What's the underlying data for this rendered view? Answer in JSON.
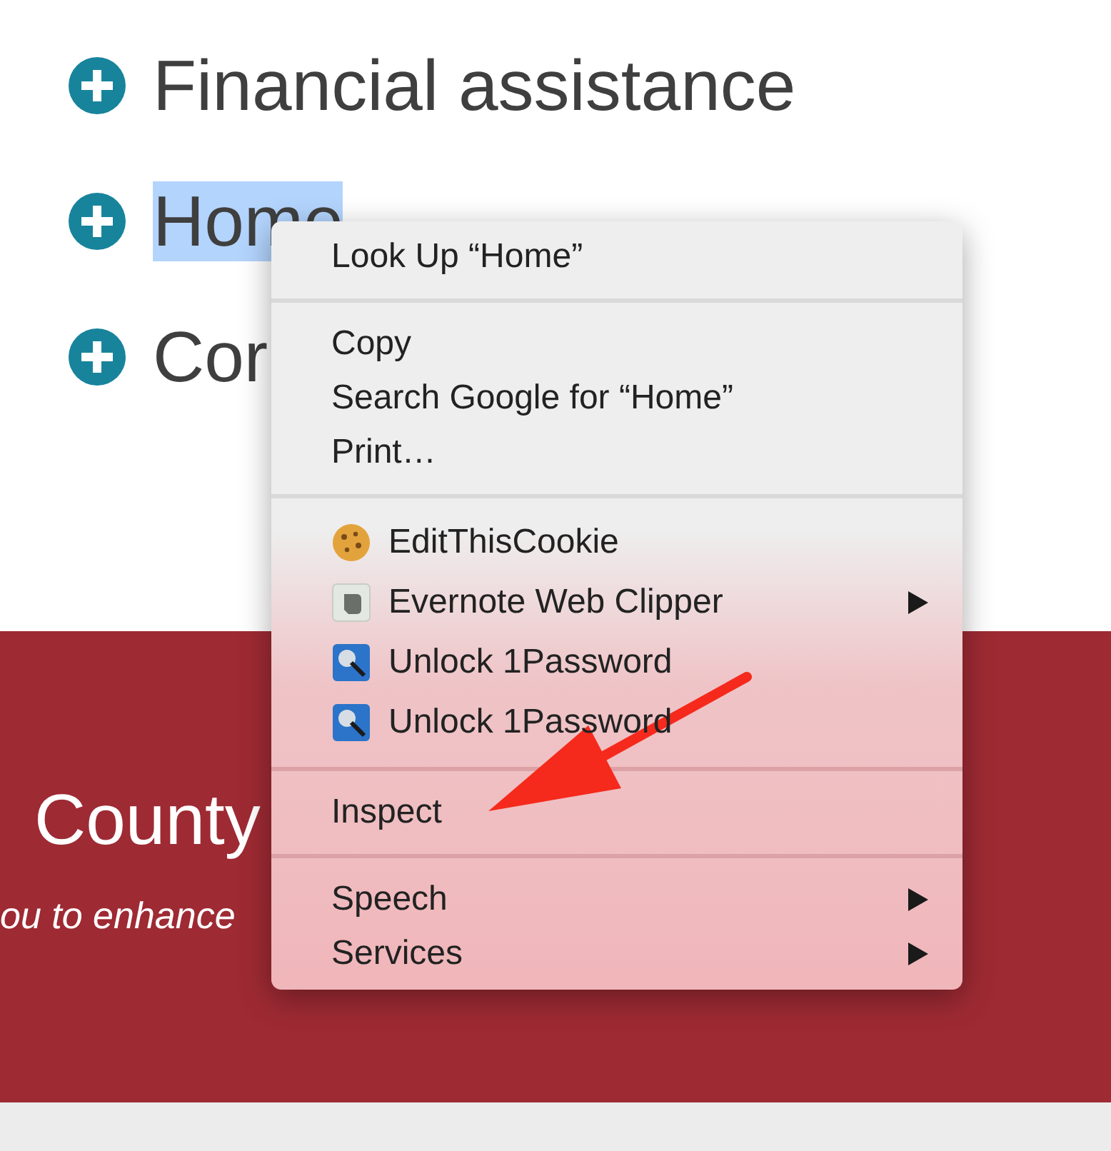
{
  "list_items": [
    {
      "label": "Financial assistance"
    },
    {
      "selection": "Home"
    },
    {
      "label": "Cor"
    }
  ],
  "banner": {
    "heading": "County",
    "tagline": "ou to enhance"
  },
  "context_menu": {
    "sections": [
      [
        {
          "kind": "plain",
          "label": "Look Up “Home”",
          "submenu": false
        }
      ],
      [
        {
          "kind": "plain",
          "label": "Copy",
          "submenu": false
        },
        {
          "kind": "plain",
          "label": "Search Google for “Home”",
          "submenu": false
        },
        {
          "kind": "plain",
          "label": "Print…",
          "submenu": false
        }
      ],
      [
        {
          "kind": "cookie",
          "label": "EditThisCookie",
          "submenu": false
        },
        {
          "kind": "clipper",
          "label": "Evernote Web Clipper",
          "submenu": true
        },
        {
          "kind": "password",
          "label": "Unlock 1Password",
          "submenu": false
        },
        {
          "kind": "password",
          "label": "Unlock 1Password",
          "submenu": false
        }
      ],
      [
        {
          "kind": "plain",
          "label": "Inspect",
          "submenu": false
        }
      ],
      [
        {
          "kind": "plain",
          "label": "Speech",
          "submenu": true
        },
        {
          "kind": "plain",
          "label": "Services",
          "submenu": true
        }
      ]
    ]
  }
}
